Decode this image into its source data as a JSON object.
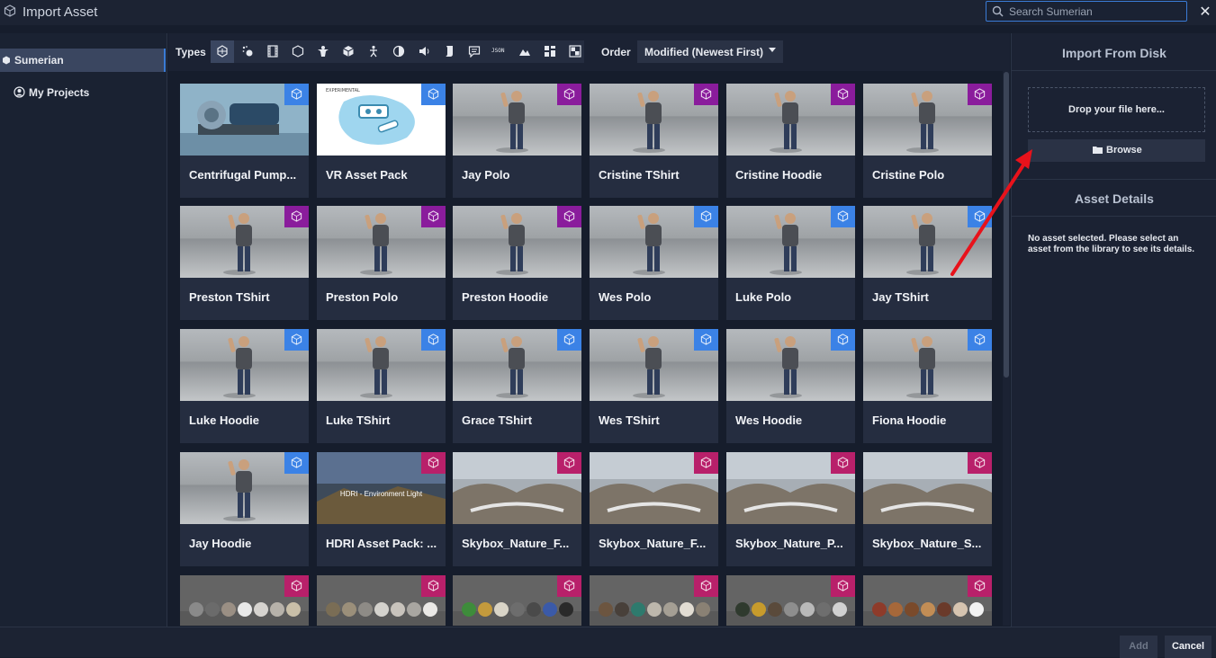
{
  "window": {
    "title": "Import Asset",
    "close_label": "✕"
  },
  "search": {
    "placeholder": "Search Sumerian",
    "value": ""
  },
  "sidebar": {
    "items": [
      {
        "label": "Sumerian",
        "active": true
      },
      {
        "label": "My Projects",
        "active": false
      }
    ]
  },
  "toolbar": {
    "types_label": "Types",
    "type_icons": [
      "all-types-icon",
      "particles-icon",
      "video-icon",
      "shape-icon",
      "host-icon",
      "box-icon",
      "figure-icon",
      "sphere-icon",
      "audio-icon",
      "script-icon",
      "speech-icon",
      "json-icon",
      "terrain-icon",
      "grid-icon",
      "image-icon"
    ],
    "json_text": "JSON",
    "order_label": "Order",
    "order_value": "Modified (Newest First)"
  },
  "colors": {
    "badge_blue": "#3b82e6",
    "badge_purple": "#8a1c9c",
    "badge_magenta": "#b8206a",
    "accent": "#3a7bd5",
    "arrow": "#e8121b"
  },
  "assets": [
    {
      "name": "Centrifugal Pump...",
      "badge": "blue",
      "thumb": "pump"
    },
    {
      "name": "VR Asset Pack",
      "badge": "blue",
      "thumb": "vr",
      "experimental": "EXPERIMENTAL"
    },
    {
      "name": "Jay Polo",
      "badge": "purple",
      "thumb": "person"
    },
    {
      "name": "Cristine TShirt",
      "badge": "purple",
      "thumb": "person"
    },
    {
      "name": "Cristine Hoodie",
      "badge": "purple",
      "thumb": "person"
    },
    {
      "name": "Cristine Polo",
      "badge": "purple",
      "thumb": "person"
    },
    {
      "name": "Preston TShirt",
      "badge": "purple",
      "thumb": "person"
    },
    {
      "name": "Preston Polo",
      "badge": "purple",
      "thumb": "person"
    },
    {
      "name": "Preston Hoodie",
      "badge": "purple",
      "thumb": "person"
    },
    {
      "name": "Wes Polo",
      "badge": "blue",
      "thumb": "person"
    },
    {
      "name": "Luke Polo",
      "badge": "blue",
      "thumb": "person"
    },
    {
      "name": "Jay TShirt",
      "badge": "blue",
      "thumb": "person"
    },
    {
      "name": "Luke Hoodie",
      "badge": "blue",
      "thumb": "person"
    },
    {
      "name": "Luke TShirt",
      "badge": "blue",
      "thumb": "person"
    },
    {
      "name": "Grace TShirt",
      "badge": "blue",
      "thumb": "person"
    },
    {
      "name": "Wes TShirt",
      "badge": "blue",
      "thumb": "person"
    },
    {
      "name": "Wes Hoodie",
      "badge": "blue",
      "thumb": "person"
    },
    {
      "name": "Fiona Hoodie",
      "badge": "blue",
      "thumb": "person"
    },
    {
      "name": "Jay Hoodie",
      "badge": "blue",
      "thumb": "person"
    },
    {
      "name": "HDRI Asset Pack: ...",
      "badge": "magenta",
      "thumb": "hdri",
      "overlay": "HDRI - Environment Light"
    },
    {
      "name": "Skybox_Nature_F...",
      "badge": "magenta",
      "thumb": "skybox"
    },
    {
      "name": "Skybox_Nature_F...",
      "badge": "magenta",
      "thumb": "skybox"
    },
    {
      "name": "Skybox_Nature_P...",
      "badge": "magenta",
      "thumb": "skybox"
    },
    {
      "name": "Skybox_Nature_S...",
      "badge": "magenta",
      "thumb": "skybox"
    },
    {
      "name": "",
      "badge": "magenta",
      "thumb": "materials"
    },
    {
      "name": "",
      "badge": "magenta",
      "thumb": "materials"
    },
    {
      "name": "",
      "badge": "magenta",
      "thumb": "materials"
    },
    {
      "name": "",
      "badge": "magenta",
      "thumb": "materials"
    },
    {
      "name": "",
      "badge": "magenta",
      "thumb": "materials"
    },
    {
      "name": "",
      "badge": "magenta",
      "thumb": "materials"
    }
  ],
  "right_panel": {
    "import_title": "Import From Disk",
    "drop_text": "Drop your file here...",
    "browse_label": "Browse",
    "details_title": "Asset Details",
    "details_text": "No asset selected. Please select an asset from the library to see its details."
  },
  "footer": {
    "add_label": "Add",
    "cancel_label": "Cancel"
  }
}
